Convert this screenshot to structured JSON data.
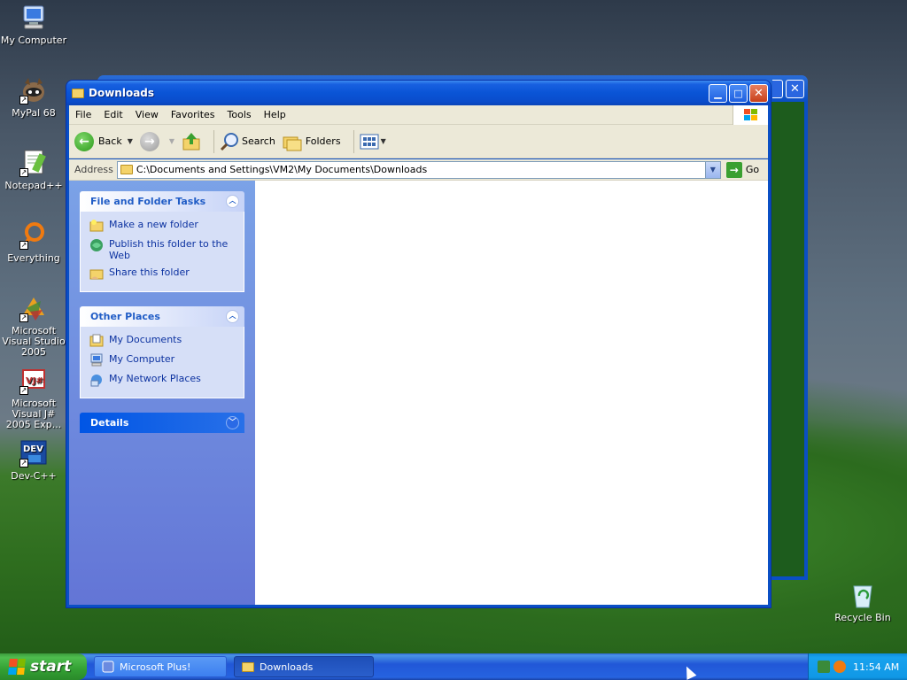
{
  "desktop": {
    "icons": [
      {
        "label": "My Computer",
        "icon": "computer-icon"
      },
      {
        "label": "MyPal 68",
        "icon": "raccoon-icon"
      },
      {
        "label": "Notepad++",
        "icon": "notepad-icon"
      },
      {
        "label": "Everything",
        "icon": "magnifier-icon"
      },
      {
        "label": "Microsoft Visual Studio 2005",
        "icon": "visual-studio-icon"
      },
      {
        "label": "Microsoft Visual J# 2005 Exp...",
        "icon": "vjsharp-icon"
      },
      {
        "label": "Dev-C++",
        "icon": "devcpp-icon"
      },
      {
        "label": "Recycle Bin",
        "icon": "recycle-bin-icon"
      }
    ]
  },
  "window": {
    "title": "Downloads",
    "menu": [
      "File",
      "Edit",
      "View",
      "Favorites",
      "Tools",
      "Help"
    ],
    "toolbar": {
      "back": "Back",
      "search": "Search",
      "folders": "Folders"
    },
    "address": {
      "label": "Address",
      "value": "C:\\Documents and Settings\\VM2\\My Documents\\Downloads",
      "go": "Go"
    },
    "taskpane": {
      "file_tasks": {
        "title": "File and Folder Tasks",
        "items": [
          "Make a new folder",
          "Publish this folder to the Web",
          "Share this folder"
        ]
      },
      "other_places": {
        "title": "Other Places",
        "items": [
          "My Documents",
          "My Computer",
          "My Network Places"
        ]
      },
      "details": {
        "title": "Details"
      }
    }
  },
  "taskbar": {
    "start": "start",
    "tasks": [
      "Microsoft Plus!",
      "Downloads"
    ],
    "clock": "11:54 AM"
  },
  "colors": {
    "accent": "#0a4fc4",
    "taskpane": "#6375d6",
    "link": "#0c32a0"
  }
}
